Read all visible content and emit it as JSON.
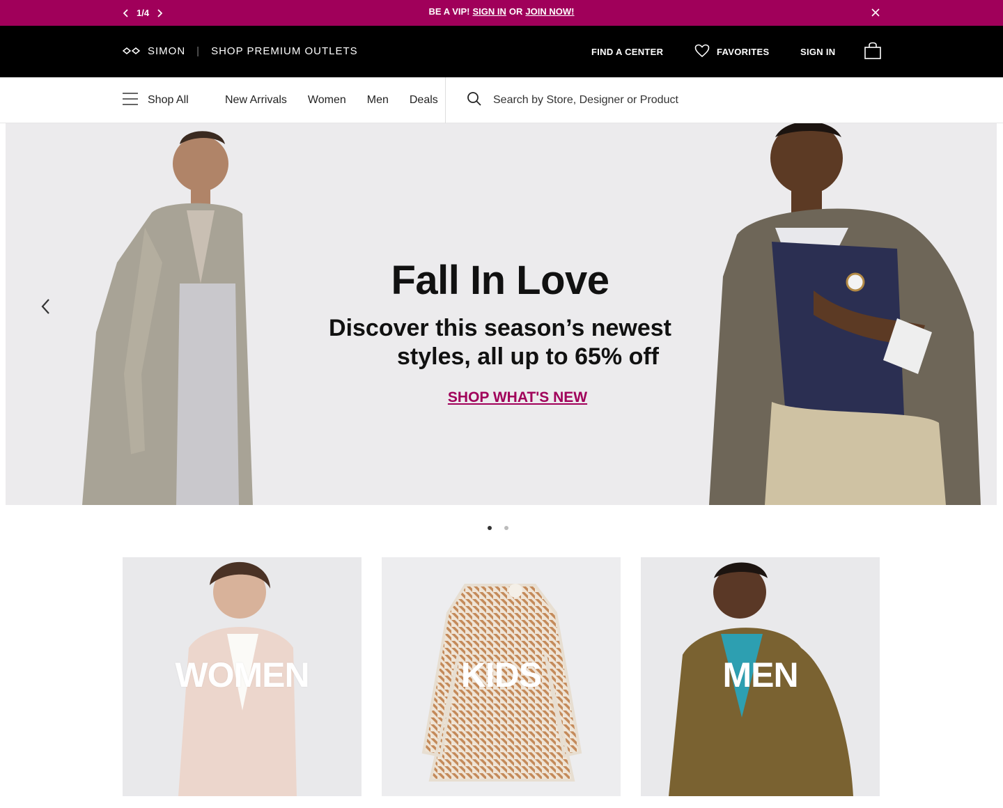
{
  "promo": {
    "pager": "1/4",
    "prefix": "BE A VIP!",
    "sign_in": "SIGN IN",
    "or": "OR",
    "join": "JOIN NOW!"
  },
  "header": {
    "brand": "SIMON",
    "tagline": "SHOP PREMIUM OUTLETS",
    "find_center": "FIND A CENTER",
    "favorites": "FAVORITES",
    "sign_in": "SIGN IN"
  },
  "nav": {
    "shop_all": "Shop All",
    "links": [
      "New Arrivals",
      "Women",
      "Men",
      "Deals"
    ],
    "search_placeholder": "Search by Store, Designer or Product"
  },
  "hero": {
    "title": "Fall In Love",
    "subtitle_line1": "Discover this season’s newest",
    "subtitle_line2": "styles, all up to 65% off",
    "cta": "SHOP WHAT'S NEW"
  },
  "categories": [
    {
      "label": "WOMEN"
    },
    {
      "label": "KIDS"
    },
    {
      "label": "MEN"
    }
  ],
  "colors": {
    "brand": "#a0005a",
    "header_bg": "#000000"
  }
}
